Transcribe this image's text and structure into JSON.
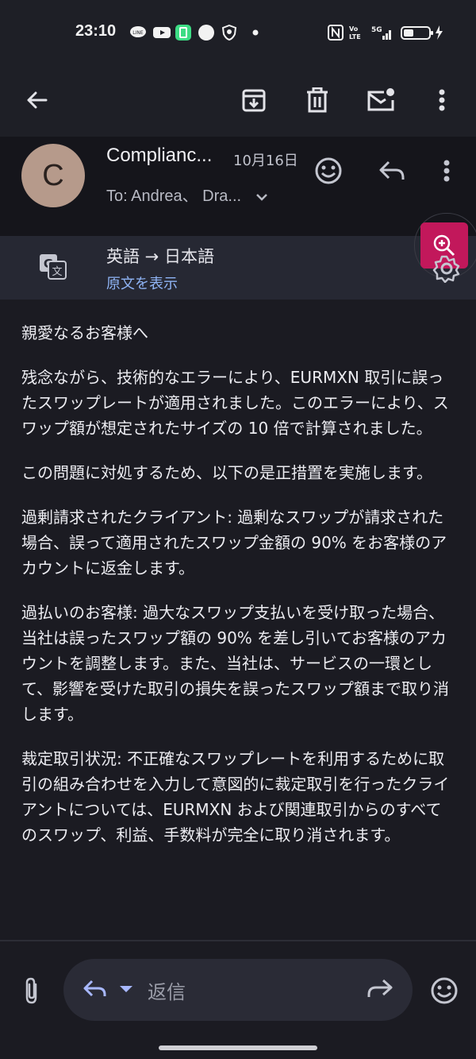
{
  "status_bar": {
    "time": "23:10"
  },
  "toolbar": {
    "back_icon": "arrow-left-icon",
    "archive_icon": "archive-icon",
    "delete_icon": "trash-icon",
    "mark_unread_icon": "mail-unread-icon",
    "more_icon": "more-vert-icon"
  },
  "email": {
    "avatar_letter": "C",
    "sender": "Complianc...",
    "date": "10月16日",
    "to": "To: Andrea、 Dra..."
  },
  "translation": {
    "title": "英語 → 日本語",
    "show_original": "原文を表示"
  },
  "body": {
    "paragraphs": [
      "親愛なるお客様へ",
      "残念ながら、技術的なエラーにより、EURMXN 取引に誤ったスワップレートが適用されました。このエラーにより、スワップ額が想定されたサイズの 10 倍で計算されました。",
      "この問題に対処するため、以下の是正措置を実施します。",
      "過剰請求されたクライアント: 過剰なスワップが請求された場合、誤って適用されたスワップ金額の 90% をお客様のアカウントに返金します。",
      "過払いのお客様: 過大なスワップ支払いを受け取った場合、当社は誤ったスワップ額の 90% を差し引いてお客様のアカウントを調整します。また、当社は、サービスの一環として、影響を受けた取引の損失を誤ったスワップ額まで取り消します。",
      "裁定取引状況: 不正確なスワップレートを利用するために取引の組み合わせを入力して意図的に裁定取引を行ったクライアントについては、EURMXN および関連取引からのすべてのスワップ、利益、手数料が完全に取り消されます。"
    ]
  },
  "compose": {
    "reply_placeholder": "返信"
  }
}
